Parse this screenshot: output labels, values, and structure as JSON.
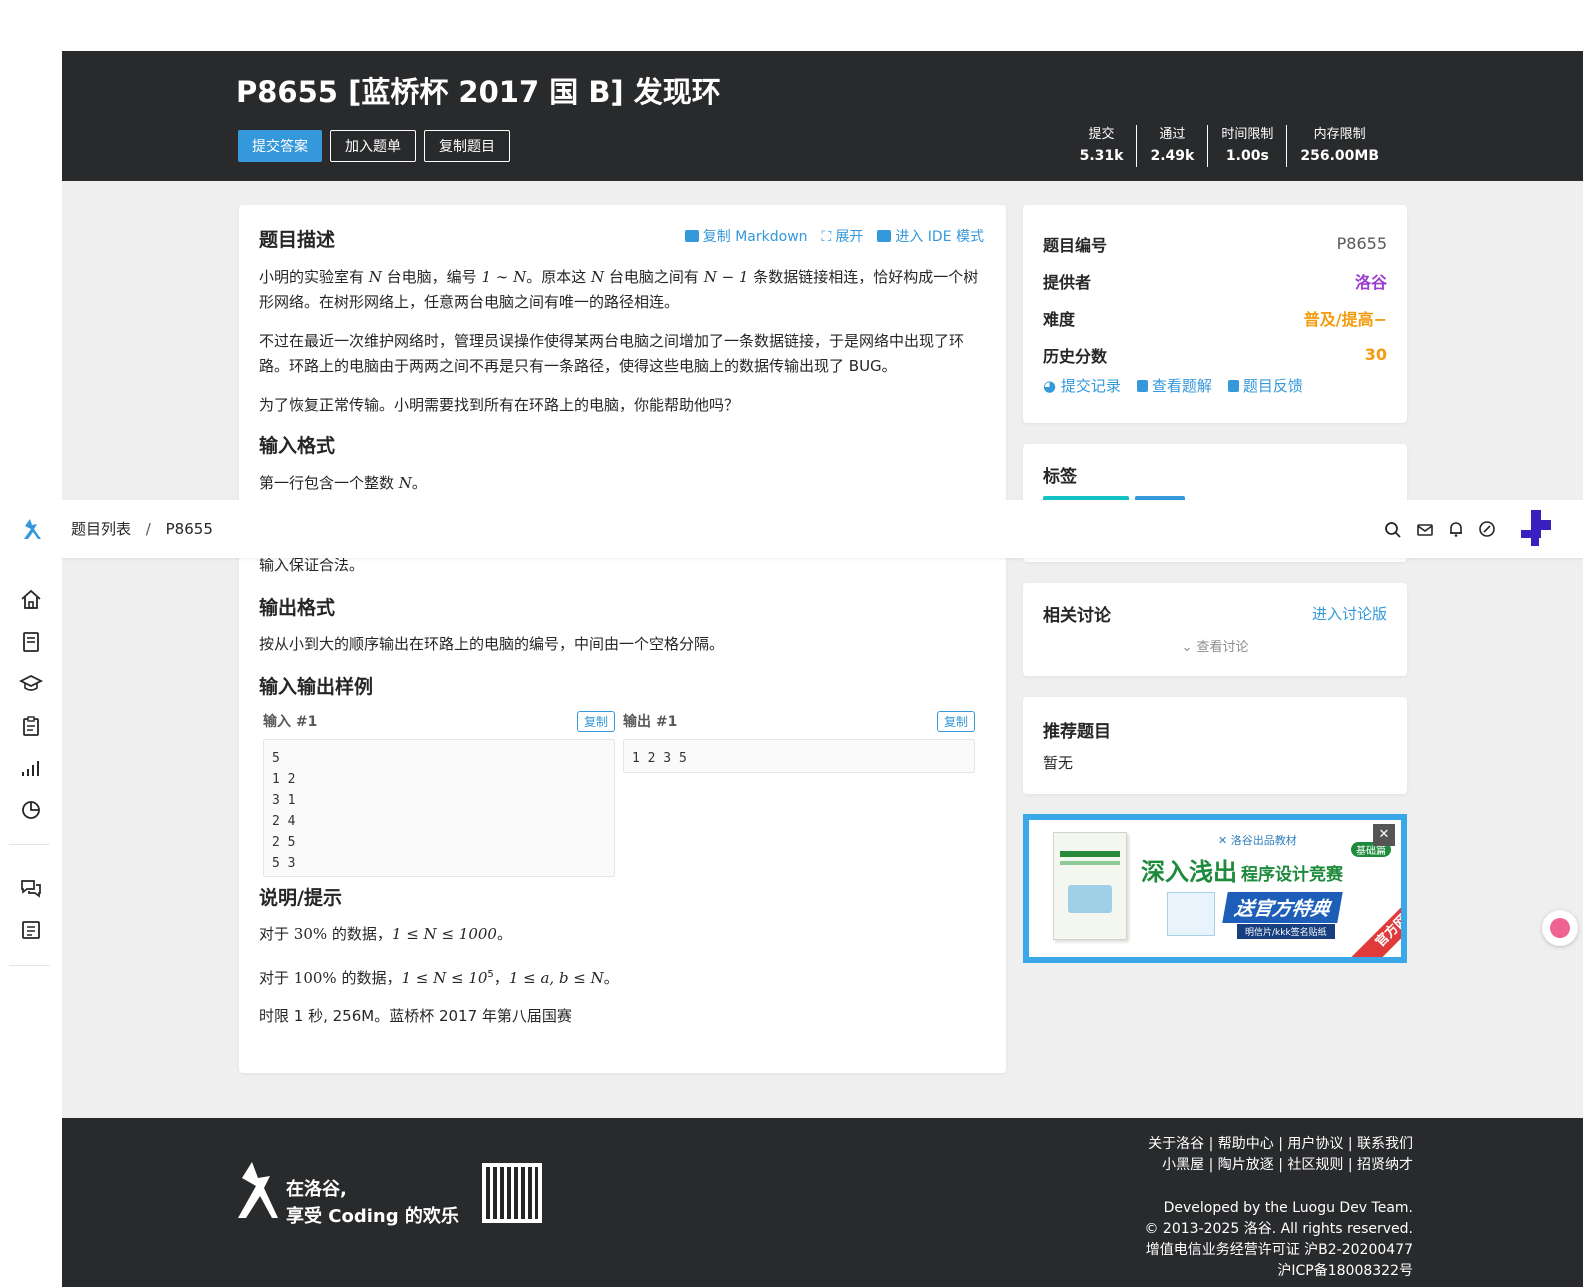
{
  "problem": {
    "title": "P8655 [蓝桥杯 2017 国 B] 发现环",
    "buttons": {
      "submit": "提交答案",
      "add_list": "加入题单",
      "copy": "复制题目"
    },
    "stats": [
      {
        "label": "提交",
        "value": "5.31k"
      },
      {
        "label": "通过",
        "value": "2.49k"
      },
      {
        "label": "时间限制",
        "value": "1.00s"
      },
      {
        "label": "内存限制",
        "value": "256.00MB"
      }
    ]
  },
  "content": {
    "desc_title": "题目描述",
    "actions": {
      "markdown": "复制 Markdown",
      "expand": "展开",
      "ide": "进入 IDE 模式"
    },
    "p1a": "小明的实验室有 ",
    "p1b": " 台电脑，编号 ",
    "p1c": "。原本这 ",
    "p1d": " 台电脑之间有 ",
    "p1e": " 条数据链接相连，恰好构成一个树形网络。在树形网络上，任意两台电脑之间有唯一的路径相连。",
    "m_N": "N",
    "m_range": "1 ∼ N",
    "m_nm1": "N − 1",
    "p2": "不过在最近一次维护网络时，管理员误操作使得某两台电脑之间增加了一条数据链接，于是网络中出现了环路。环路上的电脑由于两两之间不再是只有一条路径，使得这些电脑上的数据传输出现了 BUG。",
    "p3": "为了恢复正常传输。小明需要找到所有在环路上的电脑，你能帮助他吗？",
    "input_title": "输入格式",
    "input_p1a": "第一行包含一个整数 ",
    "input_p1b": "。",
    "input_p2": "输入保证合法。",
    "output_title": "输出格式",
    "output_p": "按从小到大的顺序输出在环路上的电脑的编号，中间由一个空格分隔。",
    "samples_title": "输入输出样例",
    "sample_in_label": "输入 #1",
    "sample_out_label": "输出 #1",
    "copy_label": "复制",
    "sample_in": "5\n1 2\n3 1\n2 4\n2 5\n5 3",
    "sample_out": "1 2 3 5",
    "hint_title": "说明/提示",
    "hint1a": "对于 ",
    "hint1_pct": "30%",
    "hint1b": " 的数据，",
    "hint1_m": "1 ≤ N ≤ 1000",
    "hint1c": "。",
    "hint2a": "对于 ",
    "hint2_pct": "100%",
    "hint2b": " 的数据，",
    "hint2_m": "1 ≤ N ≤ 10",
    "hint2_sup": "5",
    "hint2_sep": "，",
    "hint2_m2": "1 ≤ a, b ≤ N",
    "hint2c": "。",
    "hint3": "时限 1 秒, 256M。蓝桥杯 2017 年第八届国赛"
  },
  "sidebar": {
    "info": [
      {
        "key": "题目编号",
        "value": "P8655",
        "color": "#595959"
      },
      {
        "key": "提供者",
        "value": "洛谷",
        "color": "#9d3dcf"
      },
      {
        "key": "难度",
        "value": "普及/提高−",
        "color": "#f39c11"
      },
      {
        "key": "历史分数",
        "value": "30",
        "color": "#f39c11"
      }
    ],
    "links": {
      "records": "提交记录",
      "solutions": "查看题解",
      "feedback": "题目反馈"
    },
    "tags_title": "标签",
    "discuss_title": "相关讨论",
    "discuss_link": "进入讨论版",
    "discuss_view": "查看讨论",
    "recommend_title": "推荐题目",
    "recommend_empty": "暂无",
    "ad": {
      "brand": "洛谷出品教材",
      "title1": "深入浅出",
      "title2": "程序设计竞赛",
      "edition": "基础篇",
      "promo": "送官方特典",
      "sub": "明信片/kkk签名贴纸",
      "corner": "官方网店",
      "close": "✕"
    }
  },
  "nav": {
    "breadcrumb_root": "题目列表",
    "breadcrumb_sep": "/",
    "breadcrumb_current": "P8655"
  },
  "footer": {
    "links_line1": "关于洛谷 | 帮助中心 | 用户协议 | 联系我们",
    "links_line2": "小黑屋 | 陶片放逐 | 社区规则 | 招贤纳才",
    "dev": "Developed by the Luogu Dev Team.",
    "copyright": "© 2013-2025 洛谷. All rights reserved.",
    "icp1": "增值电信业务经营许可证 沪B2-20200477",
    "icp2": "沪ICP备18008322号",
    "slogan1": "在洛谷,",
    "slogan2": "享受 Coding 的欢乐"
  },
  "colors": {
    "accent": "#3498db",
    "dark": "#282a2c",
    "purple": "#9d3dcf",
    "orange": "#f39c11"
  }
}
